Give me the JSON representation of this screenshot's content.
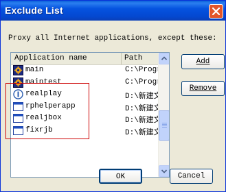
{
  "window": {
    "title": "Exclude List"
  },
  "prompt": "Proxy all Internet applications, except these:",
  "list": {
    "columns": [
      "Application name",
      "Path"
    ],
    "rows": [
      {
        "name": "main",
        "path": "C:\\Progra",
        "icon": "app-gear-icon"
      },
      {
        "name": "maintest",
        "path": "C:\\Progra",
        "icon": "app-gear-icon"
      },
      {
        "name": "realplay",
        "path": "D:\\新建文",
        "icon": "realplayer-icon"
      },
      {
        "name": "rphelperapp",
        "path": "D:\\新建文",
        "icon": "window-app-icon"
      },
      {
        "name": "realjbox",
        "path": "D:\\新建文",
        "icon": "window-app-icon"
      },
      {
        "name": "fixrjb",
        "path": "D:\\新建文",
        "icon": "window-app-icon"
      }
    ]
  },
  "buttons": {
    "add": "Add",
    "remove": "Remove",
    "ok": "OK",
    "cancel": "Cancel"
  },
  "colors": {
    "titlebar": "#0553e0",
    "highlight": "#cc0000",
    "close": "#e2552b"
  }
}
